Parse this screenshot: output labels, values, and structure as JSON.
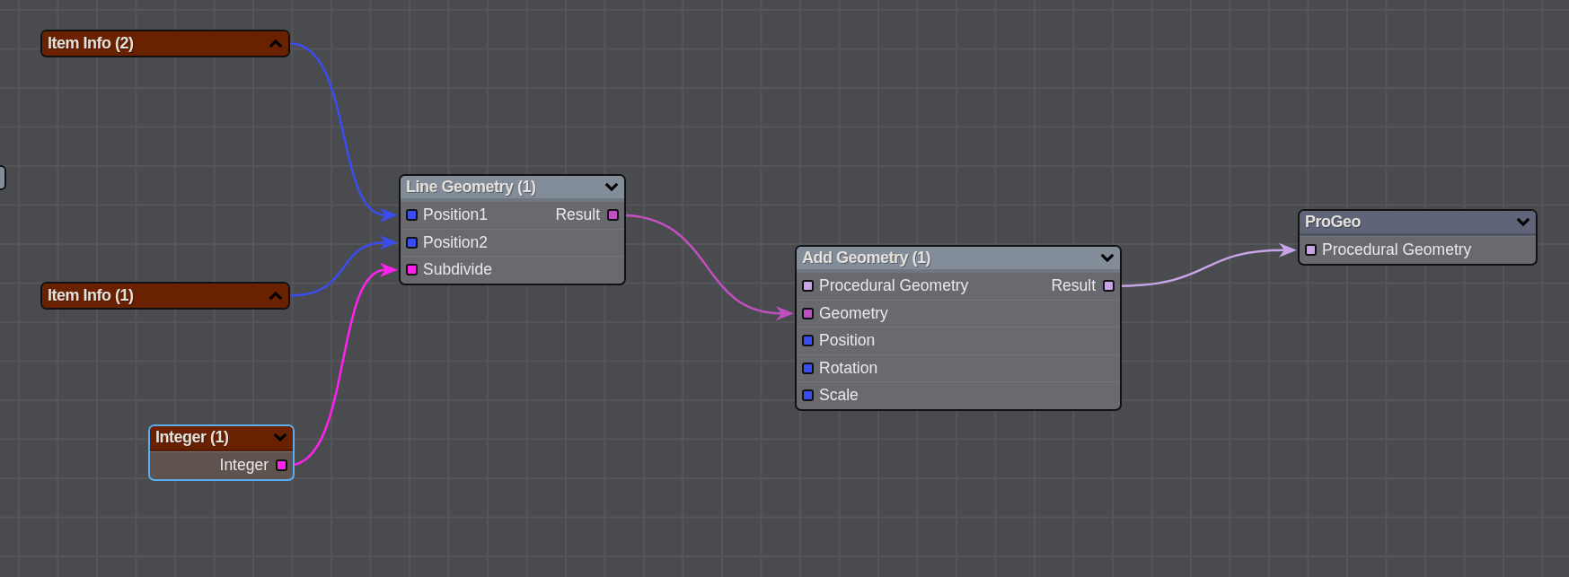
{
  "nodes": [
    {
      "title": "Item Info (2)",
      "color": "#6a2100",
      "expanded": false,
      "selected": false
    },
    {
      "title": "Item Info (1)",
      "color": "#6a2100",
      "expanded": false,
      "selected": false
    },
    {
      "title": "Line Geometry (1)",
      "color": "#838d99",
      "expanded": true,
      "selected": false,
      "rows": [
        {
          "input": {
            "label": "Position1",
            "color": "#3a4ef0"
          },
          "output": {
            "label": "Result",
            "color": "#c050c0"
          }
        },
        {
          "input": {
            "label": "Position2",
            "color": "#3a4ef0"
          }
        },
        {
          "input": {
            "label": "Subdivide",
            "color": "#ff22ee"
          }
        }
      ]
    },
    {
      "title": "Integer (1)",
      "color": "#6a2100",
      "expanded": true,
      "selected": true,
      "rows": [
        {
          "output": {
            "label": "Integer",
            "color": "#ff22ee"
          }
        }
      ]
    },
    {
      "title": "Add Geometry (1)",
      "color": "#838d99",
      "expanded": true,
      "selected": false,
      "rows": [
        {
          "input": {
            "label": "Procedural Geometry",
            "color": "#c8a4e8"
          },
          "output": {
            "label": "Result",
            "color": "#c8a4e8"
          }
        },
        {
          "input": {
            "label": "Geometry",
            "color": "#c050c0"
          }
        },
        {
          "input": {
            "label": "Position",
            "color": "#3a4ef0"
          }
        },
        {
          "input": {
            "label": "Rotation",
            "color": "#3a4ef0"
          }
        },
        {
          "input": {
            "label": "Scale",
            "color": "#3a4ef0"
          }
        }
      ]
    },
    {
      "title": "ProGeo",
      "color": "#5f6478",
      "expanded": true,
      "selected": false,
      "rows": [
        {
          "input": {
            "label": "Procedural Geometry",
            "color": "#c8a4e8"
          }
        }
      ]
    }
  ]
}
